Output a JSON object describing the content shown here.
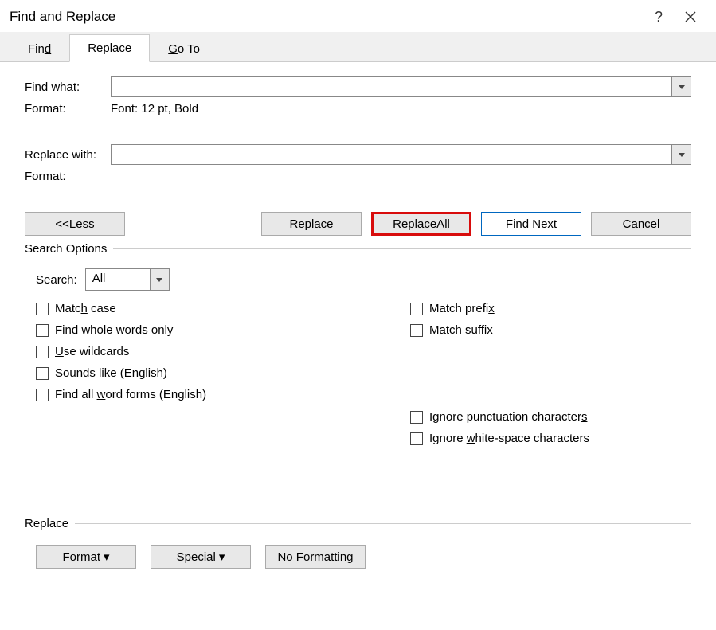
{
  "title": "Find and Replace",
  "tabs": {
    "find": "Find",
    "replace": "Replace",
    "goto": "Go To"
  },
  "findwhat_label": "Find what:",
  "findwhat_value": "",
  "format_label": "Format:",
  "findwhat_format": "Font: 12 pt, Bold",
  "replacewith_label": "Replace with:",
  "replacewith_value": "",
  "replacewith_format": "",
  "buttons": {
    "less": "<< Less",
    "replace": "Replace",
    "replaceall": "Replace All",
    "findnext": "Find Next",
    "cancel": "Cancel",
    "format": "Format",
    "special": "Special",
    "noformat": "No Formatting"
  },
  "group_search": "Search Options",
  "search_label": "Search:",
  "search_value": "All",
  "chk": {
    "matchcase": "Match case",
    "whole": "Find whole words only",
    "wildcards": "Use wildcards",
    "sounds": "Sounds like (English)",
    "allforms": "Find all word forms (English)",
    "prefix": "Match prefix",
    "suffix": "Match suffix",
    "ignorepunct": "Ignore punctuation characters",
    "ignorews": "Ignore white-space characters"
  },
  "group_replace": "Replace"
}
